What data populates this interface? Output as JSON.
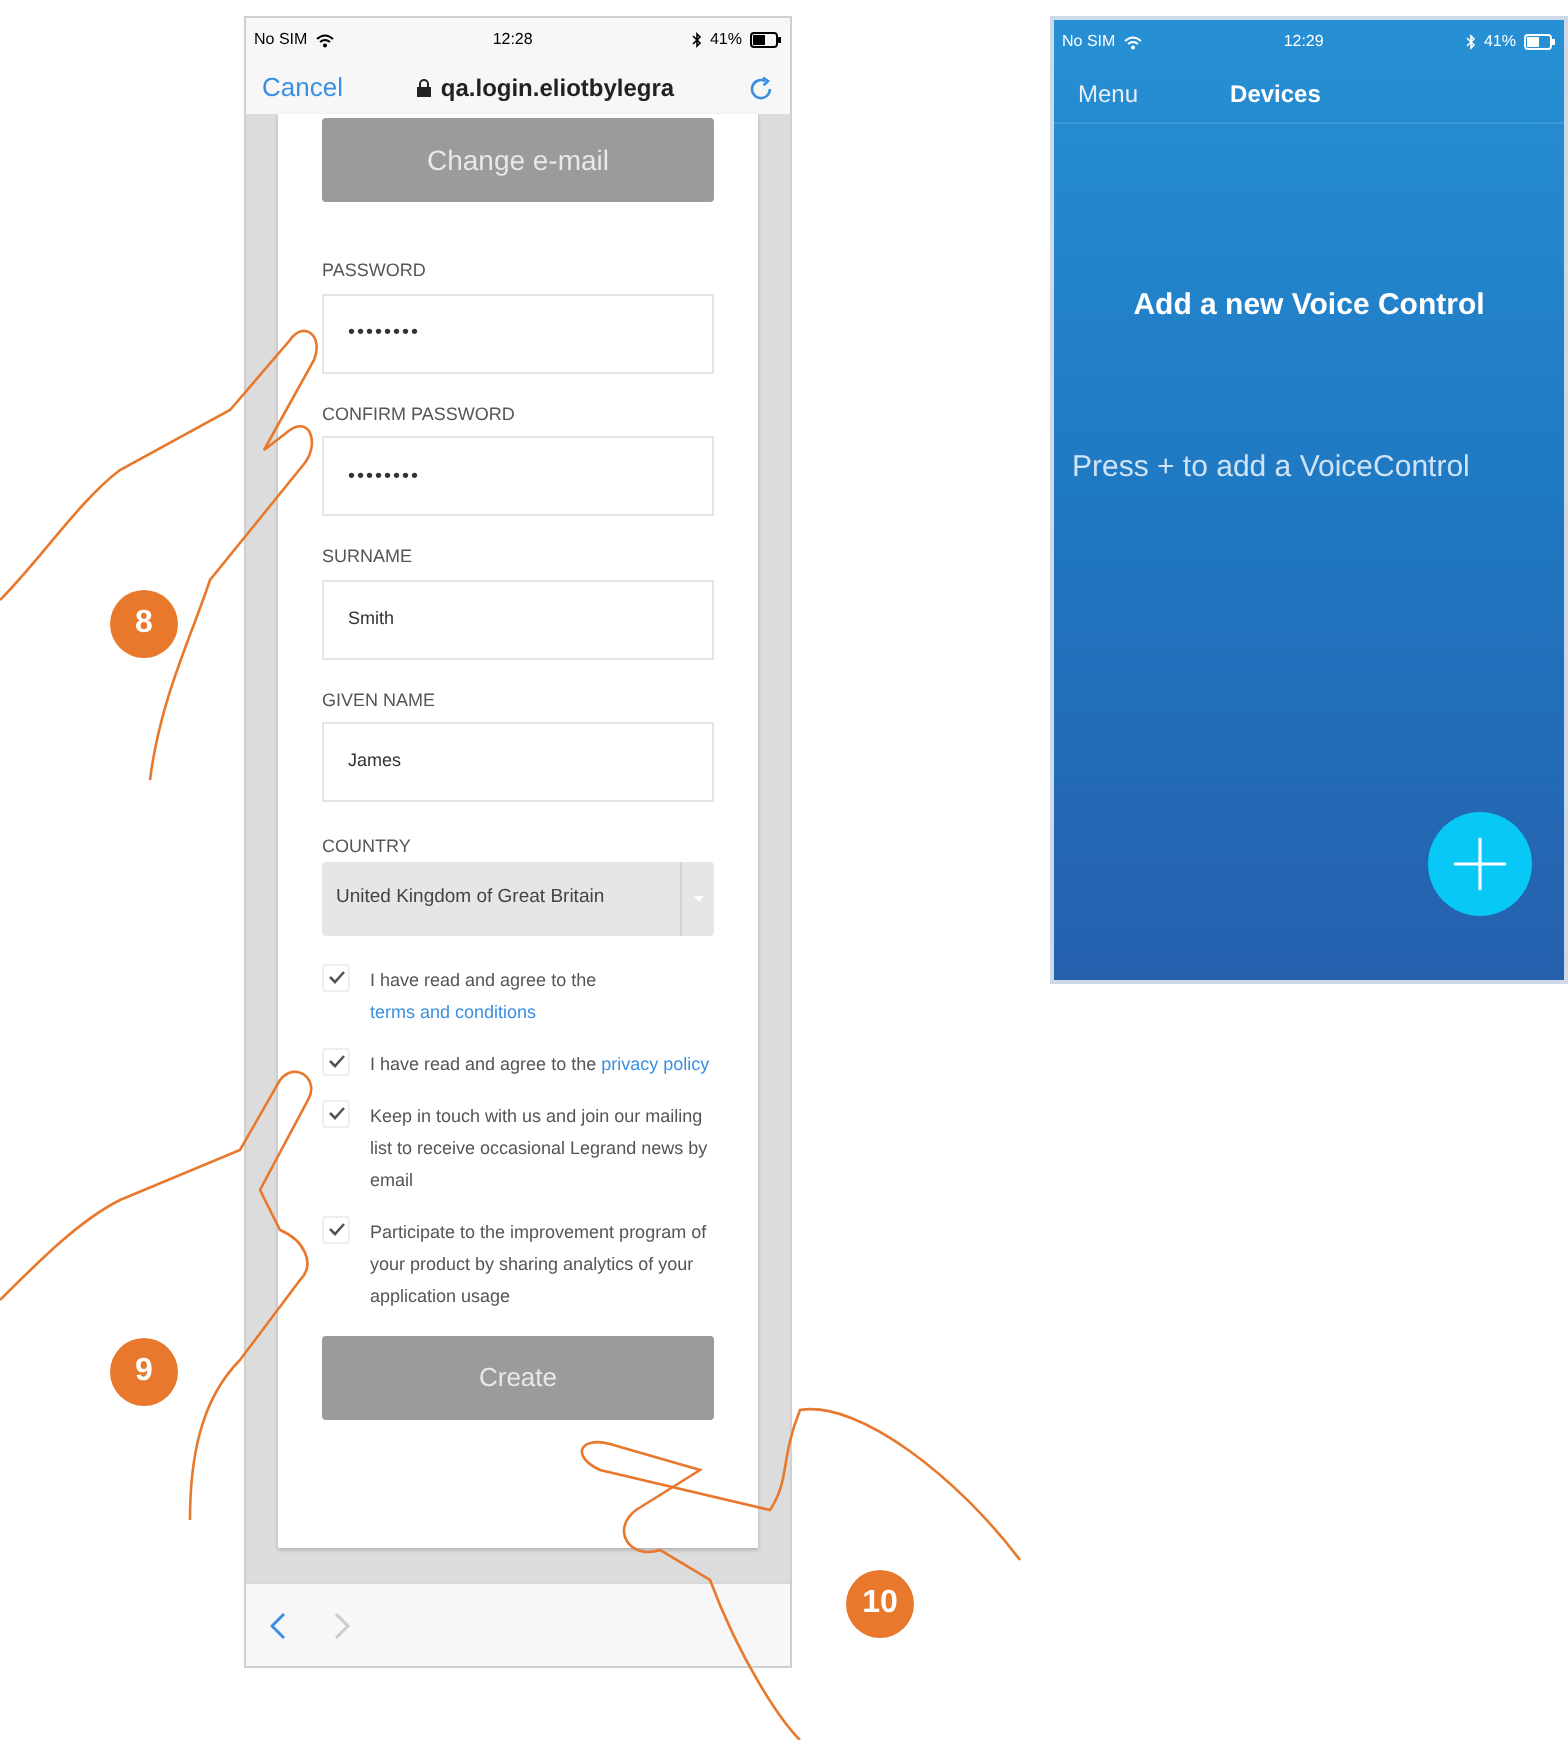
{
  "left_phone": {
    "status": {
      "carrier": "No SIM",
      "time": "12:28",
      "battery": "41%"
    },
    "browser_bar": {
      "cancel": "Cancel",
      "url": "qa.login.eliotbylegra"
    },
    "change_email": "Change e-mail",
    "fields": [
      {
        "label": "PASSWORD",
        "value": "••••••••",
        "kind": "password"
      },
      {
        "label": "CONFIRM PASSWORD",
        "value": "••••••••",
        "kind": "password"
      },
      {
        "label": "SURNAME",
        "value": "Smith",
        "kind": "text"
      },
      {
        "label": "GIVEN NAME",
        "value": "James",
        "kind": "text"
      }
    ],
    "country": {
      "label": "COUNTRY",
      "value": "United Kingdom of Great Britain"
    },
    "agreements": [
      {
        "text": "I have read and agree to the",
        "link": "terms and conditions",
        "checked": true
      },
      {
        "text": "I have read and agree to the",
        "link": "privacy policy",
        "checked": true
      },
      {
        "text": "Keep in touch with us and join our mailing list to receive occasional Legrand news by email",
        "checked": true
      },
      {
        "text": "Participate to the improvement program of your product by sharing analytics of your application usage",
        "checked": true
      }
    ],
    "create": "Create"
  },
  "right_phone": {
    "status": {
      "carrier": "No SIM",
      "time": "12:29",
      "battery": "41%"
    },
    "nav": {
      "menu": "Menu",
      "title": "Devices"
    },
    "heading": "Add a new Voice Control",
    "hint": "Press + to add a VoiceControl"
  },
  "callouts": [
    {
      "label": "8"
    },
    {
      "label": "9"
    },
    {
      "label": "10"
    }
  ]
}
